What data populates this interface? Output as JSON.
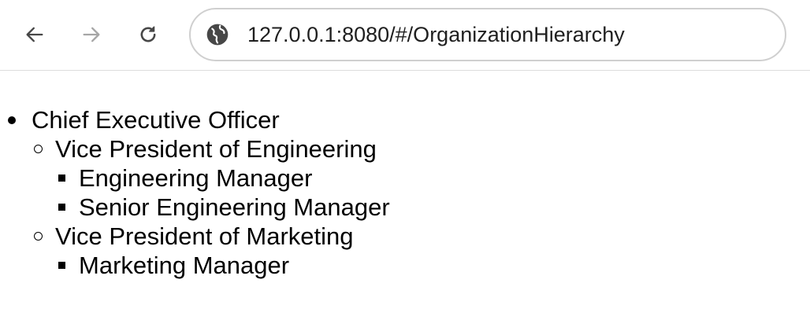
{
  "browser": {
    "url": "127.0.0.1:8080/#/OrganizationHierarchy"
  },
  "hierarchy": {
    "root": {
      "title": "Chief Executive Officer",
      "children": [
        {
          "title": "Vice President of Engineering",
          "children": [
            {
              "title": "Engineering Manager"
            },
            {
              "title": "Senior Engineering Manager"
            }
          ]
        },
        {
          "title": "Vice President of Marketing",
          "children": [
            {
              "title": "Marketing Manager"
            }
          ]
        }
      ]
    }
  },
  "icons": {
    "back": "arrow-left-icon",
    "forward": "arrow-right-icon",
    "reload": "reload-icon",
    "site": "globe-icon"
  },
  "colors": {
    "icon_active": "#474747",
    "icon_disabled": "#a6a6a6",
    "address_border": "#cfcfcf"
  }
}
